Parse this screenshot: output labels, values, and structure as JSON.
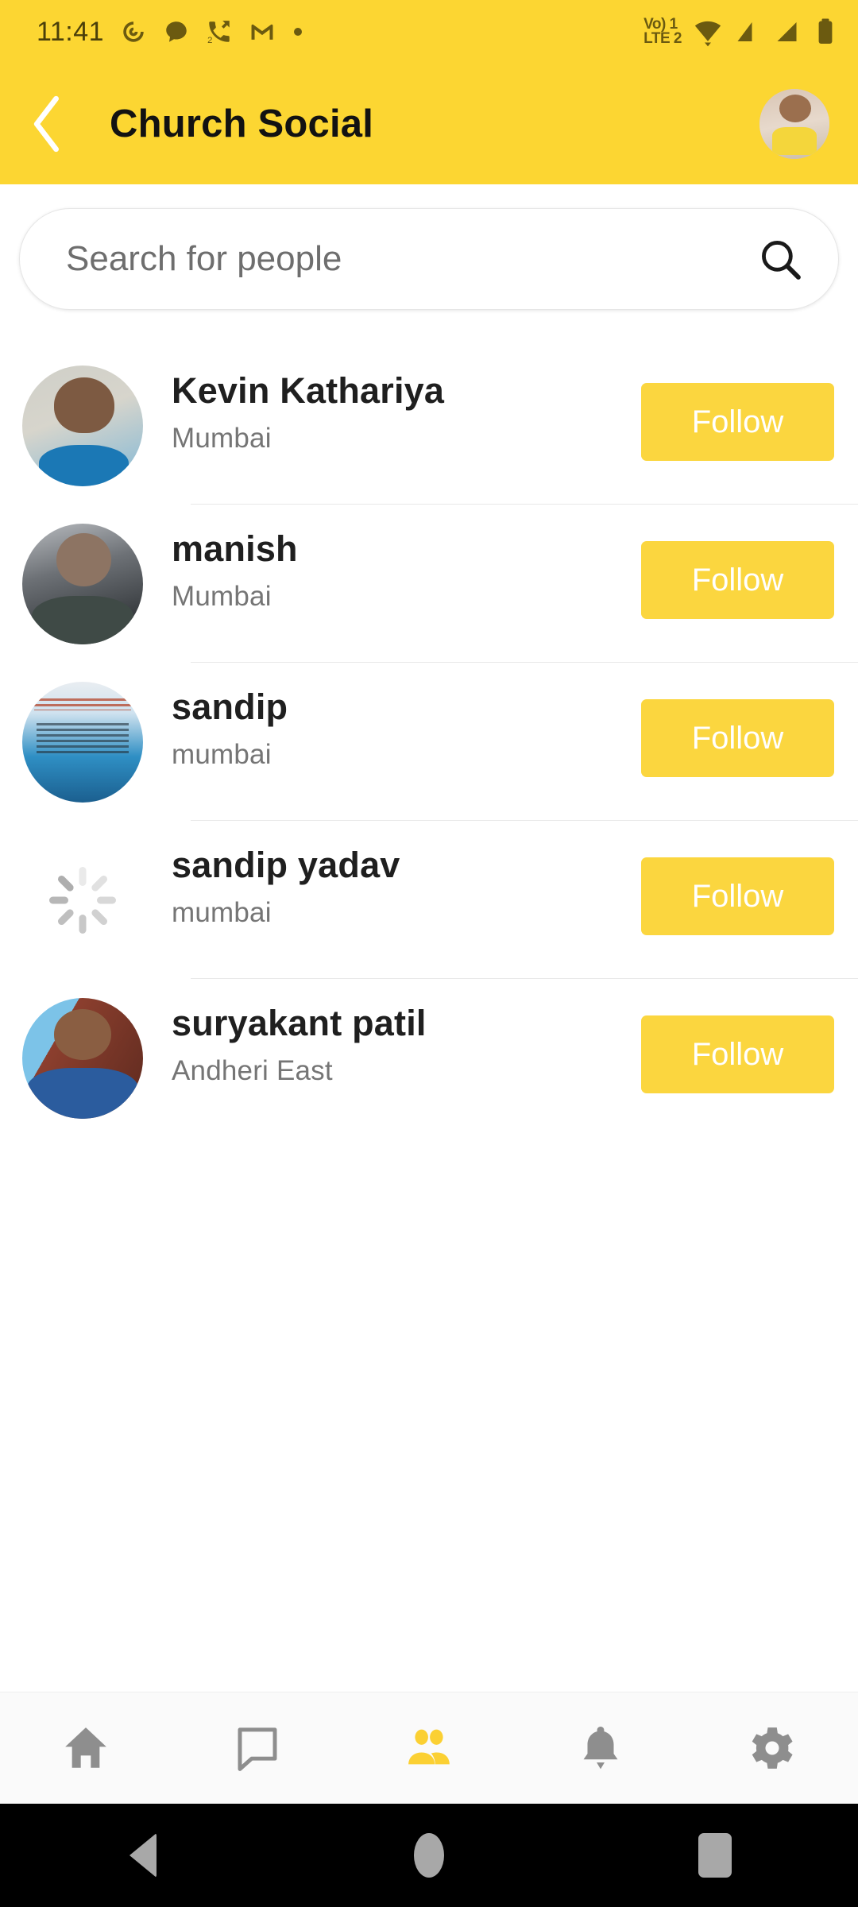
{
  "status_bar": {
    "time": "11:41",
    "notification_icons": [
      "swirl-icon",
      "chat-bubble-icon",
      "missed-call-icon",
      "gmail-icon",
      "dot-icon"
    ],
    "missed_call_badge": "2",
    "network_label_top": "Vo) 1",
    "network_label_bottom": "LTE 2",
    "system_icons": [
      "volte-icon",
      "wifi-icon",
      "signal-sim1-icon",
      "signal-sim2-icon",
      "battery-icon"
    ]
  },
  "app_bar": {
    "title": "Church Social",
    "back_icon": "chevron-left-icon",
    "avatar_icon": "profile-avatar"
  },
  "search": {
    "value": "",
    "placeholder": "Search for people",
    "icon": "search-icon"
  },
  "people": [
    {
      "name": "Kevin Kathariya",
      "location": "Mumbai",
      "action": "Follow",
      "avatar": "ph-kevin",
      "loading": false
    },
    {
      "name": "manish",
      "location": "Mumbai",
      "action": "Follow",
      "avatar": "ph-manish",
      "loading": false
    },
    {
      "name": "sandip",
      "location": "mumbai",
      "action": "Follow",
      "avatar": "ph-sandip",
      "loading": false
    },
    {
      "name": "sandip yadav",
      "location": "mumbai",
      "action": "Follow",
      "avatar": "",
      "loading": true
    },
    {
      "name": "suryakant patil",
      "location": "Andheri East",
      "action": "Follow",
      "avatar": "ph-surya",
      "loading": false
    }
  ],
  "bottom_nav": {
    "active_index": 2,
    "items": [
      {
        "icon": "home-icon",
        "label": "Home"
      },
      {
        "icon": "chat-icon",
        "label": "Chat"
      },
      {
        "icon": "people-icon",
        "label": "People"
      },
      {
        "icon": "bell-icon",
        "label": "Notifications"
      },
      {
        "icon": "gear-icon",
        "label": "Settings"
      }
    ]
  },
  "android_nav": {
    "items": [
      {
        "icon": "nav-back-icon",
        "label": "Back"
      },
      {
        "icon": "nav-home-icon",
        "label": "Home"
      },
      {
        "icon": "nav-recent-icon",
        "label": "Recents"
      }
    ]
  },
  "colors": {
    "brand_yellow": "#FCD632",
    "follow_yellow": "#FBD63F",
    "active_nav": "#FBD033",
    "inactive_nav": "#8E8E8E",
    "title_text": "#121212",
    "name_text": "#1F1F1F",
    "location_text": "#757575"
  }
}
